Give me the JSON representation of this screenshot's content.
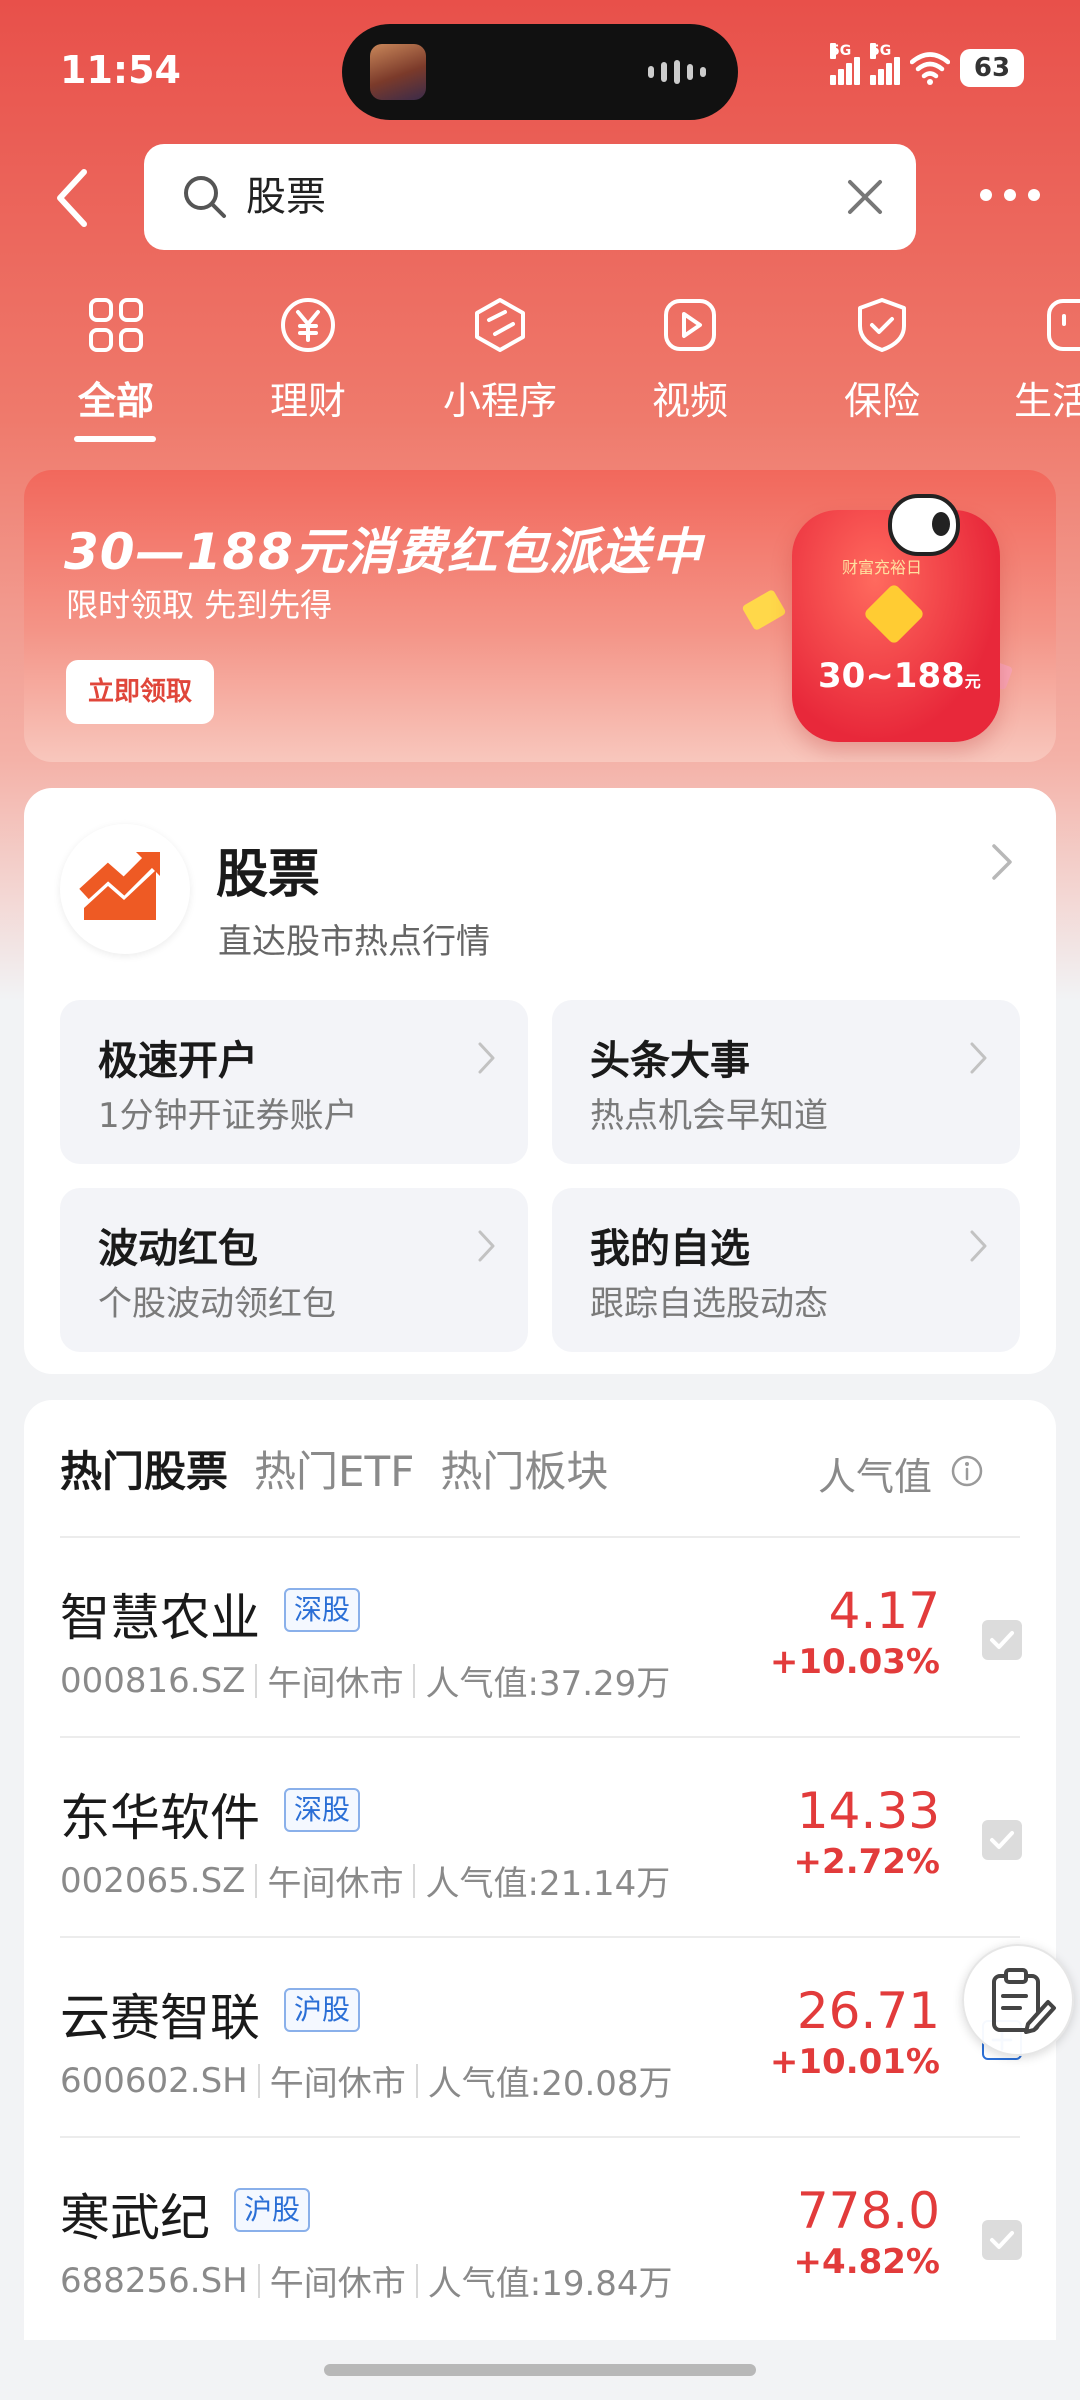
{
  "status_bar": {
    "time": "11:54",
    "battery": "63",
    "signal_1": "5G",
    "signal_2": "5G"
  },
  "search": {
    "query": "股票"
  },
  "tabs": [
    {
      "label": "全部",
      "icon": "grid-icon"
    },
    {
      "label": "理财",
      "icon": "yen-icon"
    },
    {
      "label": "小程序",
      "icon": "cube-icon"
    },
    {
      "label": "视频",
      "icon": "play-icon"
    },
    {
      "label": "保险",
      "icon": "shield-icon"
    },
    {
      "label": "生活",
      "icon": "life-icon"
    }
  ],
  "banner": {
    "title": "30—188元消费红包派送中",
    "subtitle": "限时领取 先到先得",
    "button": "立即领取",
    "packet_tag": "财富充裕日",
    "packet_amount": "30~188",
    "packet_unit": "元"
  },
  "feature": {
    "title": "股票",
    "subtitle": "直达股市热点行情",
    "tiles": [
      {
        "title": "极速开户",
        "sub": "1分钟开证券账户"
      },
      {
        "title": "头条大事",
        "sub": "热点机会早知道"
      },
      {
        "title": "波动红包",
        "sub": "个股波动领红包"
      },
      {
        "title": "我的自选",
        "sub": "跟踪自选股动态"
      }
    ]
  },
  "hot": {
    "tabs": [
      "热门股票",
      "热门ETF",
      "热门板块"
    ],
    "popularity_header": "人气值",
    "rows": [
      {
        "name": "智慧农业",
        "market": "深股",
        "code": "000816.SZ",
        "status": "午间休市",
        "popularity": "人气值:37.29万",
        "price": "4.17",
        "change": "+10.03%"
      },
      {
        "name": "东华软件",
        "market": "深股",
        "code": "002065.SZ",
        "status": "午间休市",
        "popularity": "人气值:21.14万",
        "price": "14.33",
        "change": "+2.72%"
      },
      {
        "name": "云赛智联",
        "market": "沪股",
        "code": "600602.SH",
        "status": "午间休市",
        "popularity": "人气值:20.08万",
        "price": "26.71",
        "change": "+10.01%"
      },
      {
        "name": "寒武纪",
        "market": "沪股",
        "code": "688256.SH",
        "status": "午间休市",
        "popularity": "人气值:19.84万",
        "price": "778.0",
        "change": "+4.82%"
      }
    ]
  },
  "colors": {
    "accent_red": "#e23b3b",
    "badge_blue": "#2b6fd6",
    "header_red": "#e8504a"
  }
}
